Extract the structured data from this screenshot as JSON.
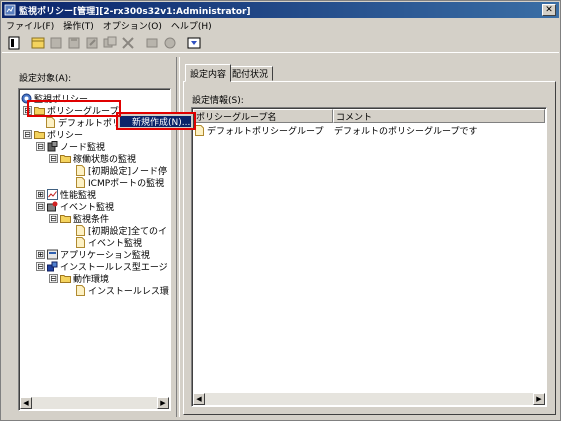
{
  "window": {
    "title": "監視ポリシー[管理][2-rx300s32v1:Administrator]",
    "close": "✕"
  },
  "menu": [
    "ファイル(F)",
    "操作(T)",
    "オプション(O)",
    "ヘルプ(H)"
  ],
  "toolbar": {
    "icons": [
      "properties-icon",
      "new-icon",
      "copy-icon",
      "paste-icon",
      "edit-icon",
      "duplicate-icon",
      "delete-icon",
      "import-icon",
      "export-icon",
      "view-icon"
    ]
  },
  "left_panel": {
    "label": "設定対象(A):",
    "tree": [
      {
        "label": "監視ポリシー",
        "icon": "policy-root-icon"
      },
      {
        "label": "ポリシーグループ",
        "icon": "folder-icon",
        "expander": "⊟"
      },
      {
        "label": "デフォルトポリ",
        "icon": "document-icon"
      },
      {
        "label": "ポリシー",
        "icon": "folder-icon",
        "expander": "⊟"
      },
      {
        "label": "ノード監視",
        "icon": "node-icon",
        "expander": "⊟"
      },
      {
        "label": "稼働状態の監視",
        "icon": "folder-icon",
        "expander": "⊟"
      },
      {
        "label": "[初期設定]ノード停",
        "icon": "document-icon"
      },
      {
        "label": "ICMPポートの監視",
        "icon": "document-icon"
      },
      {
        "label": "性能監視",
        "icon": "chart-icon",
        "expander": "⊞"
      },
      {
        "label": "イベント監視",
        "icon": "event-icon",
        "expander": "⊟"
      },
      {
        "label": "監視条件",
        "icon": "folder-icon",
        "expander": "⊟"
      },
      {
        "label": "[初期設定]全てのイ",
        "icon": "document-icon"
      },
      {
        "label": "イベント監視",
        "icon": "document-icon"
      },
      {
        "label": "アプリケーション監視",
        "icon": "app-icon",
        "expander": "⊞"
      },
      {
        "label": "インストールレス型エージ",
        "icon": "agent-icon",
        "expander": "⊟"
      },
      {
        "label": "動作環境",
        "icon": "folder-icon",
        "expander": "⊟"
      },
      {
        "label": "インストールレス環",
        "icon": "document-icon"
      }
    ]
  },
  "context_menu": {
    "item": "新規作成(N)..."
  },
  "tabs": [
    "設定内容",
    "配付状況"
  ],
  "right_panel": {
    "label": "設定情報(S):",
    "columns": [
      "ポリシーグループ名",
      "コメント"
    ],
    "rows": [
      {
        "name": "デフォルトポリシーグループ",
        "comment": "デフォルトのポリシーグループです"
      }
    ]
  },
  "colors": {
    "title_bar": "#0a246a",
    "highlight": "#e00000",
    "folder": "#f4d35e"
  }
}
